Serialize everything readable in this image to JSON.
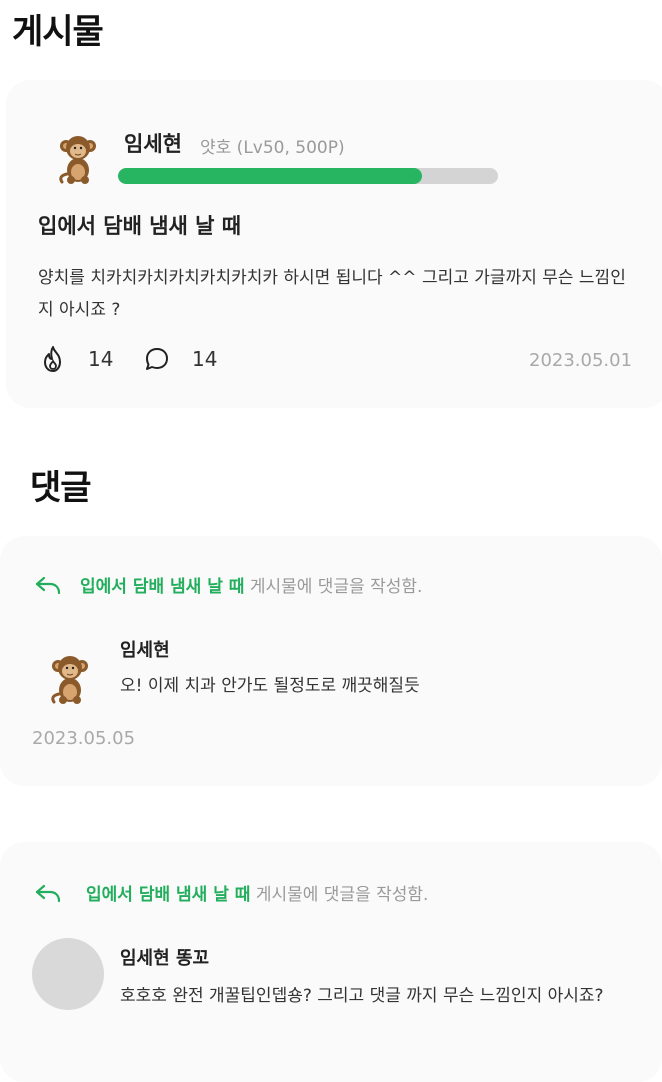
{
  "posts_section": {
    "title": "게시물"
  },
  "post": {
    "author_name": "임세현",
    "author_meta": "얏호 (Lv50, 500P)",
    "level_progress": 0.8,
    "title": "입에서 담배 냄새 날 때",
    "content": "양치를 치카치카치카치카치카치카 하시면 됩니다 ^^ 그리고 가글까지 무슨 느낌인지 아시죠 ?",
    "likes": "14",
    "comments": "14",
    "date": "2023.05.01"
  },
  "comments_section": {
    "title": "댓글",
    "comments": [
      {
        "post_title": "입에서 담배 냄새 날 때",
        "ref_suffix": " 게시물에 댓글을 작성함.",
        "author": "임세현",
        "text": "오! 이제 치과 안가도 될정도로 깨끗해질듯",
        "date": "2023.05.05"
      },
      {
        "post_title": "입에서 담배 냄새 날 때",
        "ref_suffix": " 게시물에 댓글을 작성함.",
        "author": "임세현 똥꼬",
        "text": "호호호 완전 개꿀팁인뎁숑? 그리고 댓글 까지 무슨 느낌인지 아시죠?"
      }
    ]
  },
  "colors": {
    "accent": "#22ae5c",
    "progress_track": "#d4d4d4",
    "card_bg": "#fafafa",
    "muted": "#9a9a9a"
  },
  "icons": {
    "avatar": "monkey-icon",
    "like": "fire-icon",
    "comment": "speech-bubble-icon",
    "reply": "reply-arrow-icon"
  }
}
